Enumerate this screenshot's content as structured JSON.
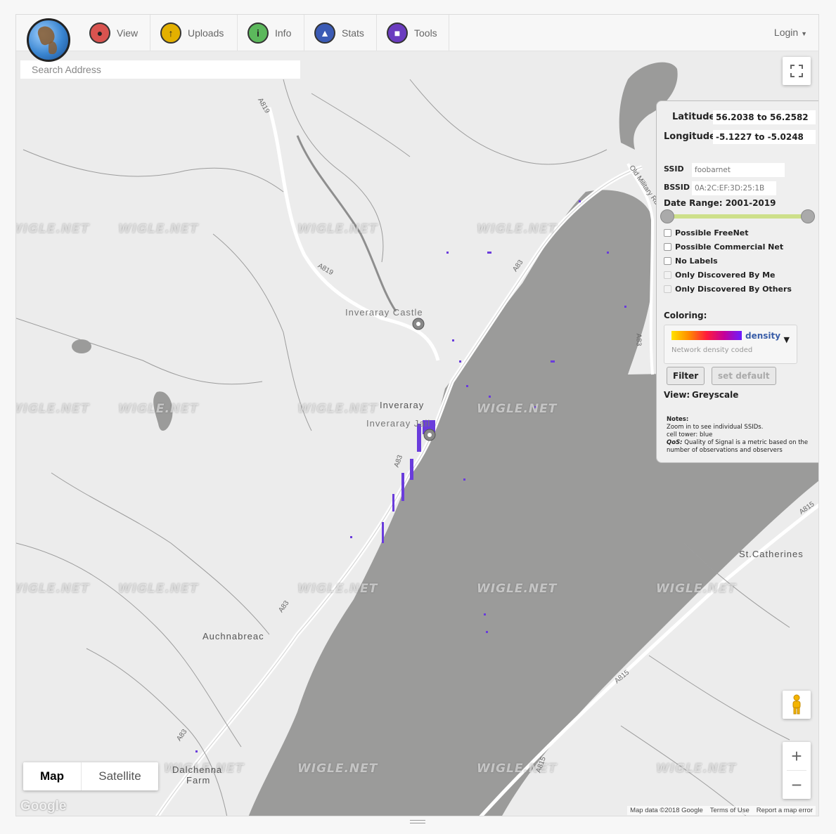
{
  "nav": {
    "items": [
      {
        "label": "View",
        "icon": "map-pin-icon",
        "color": "#d9534f"
      },
      {
        "label": "Uploads",
        "icon": "upload-icon",
        "color": "#e3b000"
      },
      {
        "label": "Info",
        "icon": "info-icon",
        "color": "#5cb85c"
      },
      {
        "label": "Stats",
        "icon": "stats-icon",
        "color": "#3b5bb5"
      },
      {
        "label": "Tools",
        "icon": "tools-icon",
        "color": "#6a3cbf"
      }
    ],
    "login": "Login"
  },
  "search": {
    "placeholder": "Search Address"
  },
  "map": {
    "watermark": "WIGLE.NET",
    "place_labels": [
      "Inveraray Castle",
      "Inveraray",
      "Inveraray Jail",
      "Auchnabreac",
      "St.Catherines",
      "Dalchenna",
      "Farm"
    ],
    "road_labels": [
      "A819",
      "A819",
      "A83",
      "A83",
      "A83",
      "A83",
      "A83",
      "A815",
      "A815",
      "A815",
      "Old Military Rd"
    ],
    "water_color": "#9b9b9a",
    "land_color": "#ececec",
    "point_color": "#6a3cdc"
  },
  "panel": {
    "latitude_label": "Latitude",
    "latitude_value": "56.2038 to 56.2582",
    "longitude_label": "Longitude",
    "longitude_value": "-5.1227 to -5.0248",
    "ssid_label": "SSID",
    "ssid_placeholder": "foobarnet",
    "bssid_label": "BSSID",
    "bssid_placeholder": "0A:2C:EF:3D:25:1B",
    "date_range_label": "Date Range: 2001-2019",
    "checkboxes": [
      {
        "label": "Possible FreeNet",
        "enabled": true
      },
      {
        "label": "Possible Commercial Net",
        "enabled": true
      },
      {
        "label": "No Labels",
        "enabled": true
      },
      {
        "label": "Only Discovered By Me",
        "enabled": false
      },
      {
        "label": "Only Discovered By Others",
        "enabled": false
      }
    ],
    "coloring_label": "Coloring:",
    "coloring_selected": "density",
    "coloring_desc": "Network density coded",
    "filter_button": "Filter",
    "set_default_button": "set default",
    "view_label": "View:",
    "view_value": "Greyscale",
    "notes_title": "Notes:",
    "notes_line1": "Zoom in to see individual SSIDs.",
    "notes_line2": "cell tower: blue",
    "notes_qos_label": "QoS:",
    "notes_qos_text": " Quality of Signal is a metric based on the number of observations and observers"
  },
  "maptype": {
    "map": "Map",
    "satellite": "Satellite"
  },
  "attribution": {
    "google": "Google",
    "map_data": "Map data ©2018 Google",
    "terms": "Terms of Use",
    "report": "Report a map error"
  }
}
